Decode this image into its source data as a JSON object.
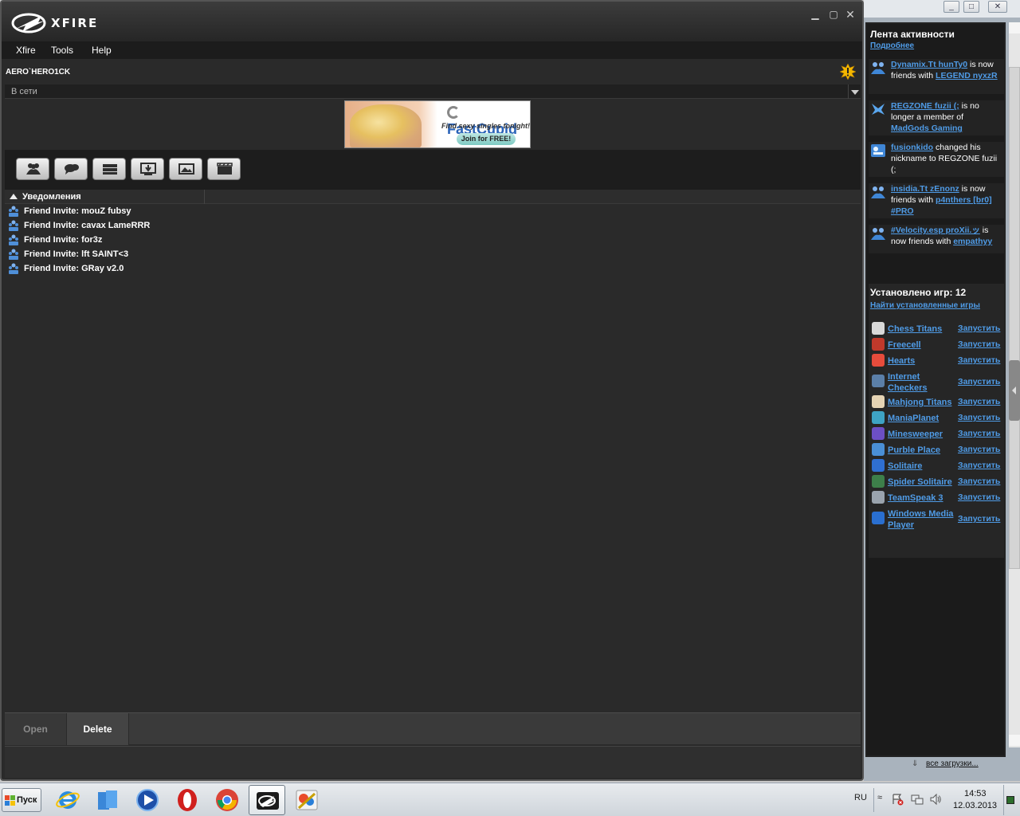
{
  "app": {
    "logo_text": "XFIRE",
    "min": "▁",
    "max": "▢",
    "close": "✕"
  },
  "menu": [
    "Xfire",
    "Tools",
    "Help"
  ],
  "user": {
    "name": "AERO`HERO1CK",
    "status": "В сети"
  },
  "ad": {
    "brand": "FastCupid",
    "tagline": "Find sexy singles tonight!",
    "cta": "Join for FREE!"
  },
  "toolbar_icons": [
    "friends-icon",
    "chat-icon",
    "servers-icon",
    "downloads-icon",
    "screenshots-icon",
    "videos-icon"
  ],
  "notifications": {
    "title": "Уведомления",
    "items": [
      "Friend Invite: mouZ fubsy",
      "Friend Invite: cavax LameRRR",
      "Friend Invite: for3z",
      "Friend Invite: lft SAINT<3",
      "Friend Invite: GRay v2.0"
    ]
  },
  "actions": {
    "open": "Open",
    "delete": "Delete"
  },
  "sidebar": {
    "window_buttons": {
      "min": "_",
      "max": "□",
      "close": "✕"
    },
    "feed_title": "Лента активности",
    "feed_more": "Подробнее",
    "feed": [
      {
        "icon": "friends-icon",
        "parts": [
          {
            "t": "Dynamix.Tt hunTy0",
            "link": true
          },
          {
            "t": " is now friends with ",
            "link": false
          },
          {
            "t": "LEGEND nyxzR",
            "link": true
          }
        ]
      },
      {
        "icon": "clan-icon",
        "parts": [
          {
            "t": "REGZONE fuzii (;",
            "link": true
          },
          {
            "t": " is no longer a member of ",
            "link": false
          },
          {
            "t": "MadGods Gaming",
            "link": true
          }
        ]
      },
      {
        "icon": "nickname-icon",
        "parts": [
          {
            "t": "fusionkido",
            "link": true
          },
          {
            "t": " changed his nickname to REGZONE fuzii (;",
            "link": false
          }
        ]
      },
      {
        "icon": "friends-icon",
        "parts": [
          {
            "t": "insidia.Tt zEnonz",
            "link": true
          },
          {
            "t": " is now friends with ",
            "link": false
          },
          {
            "t": "p4nthers [br0] #PRO",
            "link": true
          }
        ]
      },
      {
        "icon": "friends-icon",
        "parts": [
          {
            "t": "#Velocity.esp proXii.ッ",
            "link": true
          },
          {
            "t": " is now friends with ",
            "link": false
          },
          {
            "t": "empathyy",
            "link": true
          }
        ]
      }
    ],
    "games_title": "Установлено игр: 12",
    "games_link": "Найти установленные игры",
    "games": [
      {
        "name": "Chess Titans",
        "launch": "Запустить",
        "color": "#d9d9d9"
      },
      {
        "name": "Freecell",
        "launch": "Запустить",
        "color": "#c0392b"
      },
      {
        "name": "Hearts",
        "launch": "Запустить",
        "color": "#e74c3c"
      },
      {
        "name": "Internet Checkers",
        "launch": "Запустить",
        "color": "#5b7fa8"
      },
      {
        "name": "Mahjong Titans",
        "launch": "Запустить",
        "color": "#e5d3b3"
      },
      {
        "name": "ManiaPlanet",
        "launch": "Запустить",
        "color": "#3ea3c4"
      },
      {
        "name": "Minesweeper",
        "launch": "Запустить",
        "color": "#6c4fc4"
      },
      {
        "name": "Purble Place",
        "launch": "Запустить",
        "color": "#4a8fd6"
      },
      {
        "name": "Solitaire",
        "launch": "Запустить",
        "color": "#2f6fd1"
      },
      {
        "name": "Spider Solitaire",
        "launch": "Запустить",
        "color": "#3d7f4a"
      },
      {
        "name": "TeamSpeak 3",
        "launch": "Запустить",
        "color": "#9aa3ad"
      },
      {
        "name": "Windows Media Player",
        "launch": "Запустить",
        "color": "#2a6fd0"
      }
    ],
    "downloads_link": "все загрузки..."
  },
  "taskbar": {
    "start_label": "Пуск",
    "apps": [
      "internet-explorer-icon",
      "file-explorer-icon",
      "media-player-icon",
      "opera-icon",
      "chrome-icon",
      "xfire-icon",
      "paint-icon"
    ],
    "lang": "RU",
    "tray_up": "≈",
    "time": "14:53",
    "date": "12.03.2013"
  }
}
